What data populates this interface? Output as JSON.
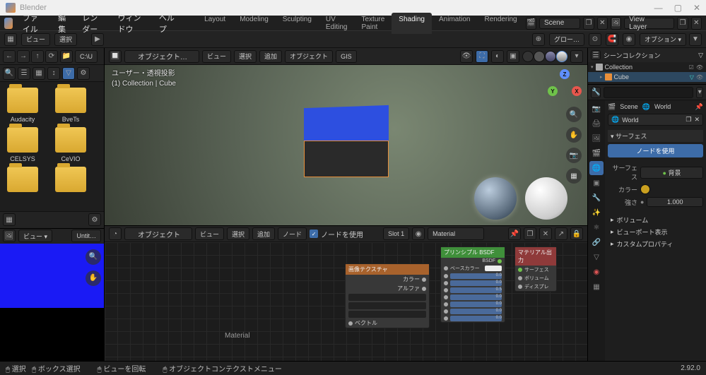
{
  "window": {
    "title": "Blender"
  },
  "menu": {
    "items": [
      "ファイル",
      "編集",
      "レンダー",
      "ウィンドウ",
      "ヘルプ"
    ]
  },
  "workspaces": {
    "tabs": [
      "Layout",
      "Modeling",
      "Sculpting",
      "UV Editing",
      "Texture Paint",
      "Shading",
      "Animation",
      "Rendering"
    ],
    "active": "Shading"
  },
  "scene": {
    "label": "Scene",
    "layer_label": "View Layer"
  },
  "subheader": {
    "editor_type": "ビュー",
    "select_label": "選択",
    "view_btn": "グロー…",
    "overlay_dd": "オブション ▾"
  },
  "filebrowser": {
    "folders": [
      "Audacity",
      "BveTs",
      "CELSYS",
      "CeVIO"
    ],
    "partial_folders": 2
  },
  "viewport": {
    "header": {
      "mode_label": "オブジェクト…",
      "menus": [
        "ビュー",
        "選択",
        "追加",
        "オブジェクト",
        "GIS"
      ]
    },
    "overlay_line1": "ユーザー・透視投影",
    "overlay_line2": "(1) Collection | Cube"
  },
  "node_editor": {
    "header": {
      "mode_label": "オブジェクト",
      "menus": [
        "ビュー",
        "選択",
        "追加",
        "ノード"
      ],
      "use_nodes": "ノードを使用",
      "slot": "Slot 1",
      "material": "Material"
    },
    "nodes": {
      "tex": {
        "title": "画像テクスチャ",
        "out1": "カラー",
        "out2": "アルファ"
      },
      "bsdf": {
        "title": "プリンシプル BSDF"
      },
      "output": {
        "title": "マテリアル出力"
      }
    },
    "material_label": "Material"
  },
  "uv": {
    "view_label": "ビュー ▾",
    "image": "Untit…"
  },
  "outliner": {
    "title": "シーンコレクション",
    "collection": "Collection",
    "object": "Cube"
  },
  "properties": {
    "search_placeholder": "",
    "scene_crumb": "Scene",
    "world_crumb": "World",
    "world_select": "World",
    "surface_panel": "サーフェス",
    "use_nodes_btn": "ノードを使用",
    "surface_label": "サーフェス",
    "surface_value": "背景",
    "color_label": "カラー",
    "strength_label": "強さ",
    "strength_value": "1.000",
    "sections": [
      "ボリューム",
      "ビューポート表示",
      "カスタムプロパティ"
    ]
  },
  "statusbar": {
    "select": "選択",
    "box_select": "ボックス選択",
    "rotate_view": "ビューを回転",
    "context_menu": "オブジェクトコンテクストメニュー",
    "version": "2.92.0"
  }
}
